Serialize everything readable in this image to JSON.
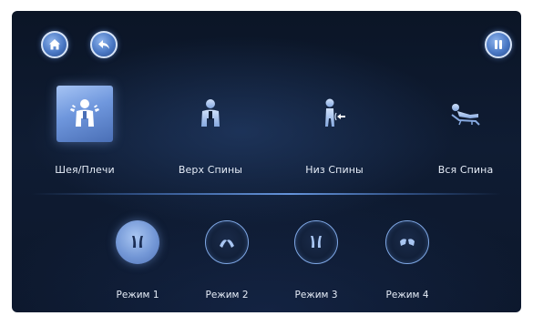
{
  "top_bar": {
    "home_icon": "home-icon",
    "back_icon": "back-arrow-icon",
    "pause_icon": "pause-icon"
  },
  "zones": [
    {
      "label": "Шея/Плечи",
      "icon": "neck-shoulders-icon",
      "selected": true
    },
    {
      "label": "Верх Спины",
      "icon": "upper-back-icon",
      "selected": false
    },
    {
      "label": "Низ Спины",
      "icon": "lower-back-icon",
      "selected": false
    },
    {
      "label": "Вся Спина",
      "icon": "full-back-icon",
      "selected": false
    }
  ],
  "modes": [
    {
      "label": "Режим 1",
      "icon": "mode-1-hands-icon",
      "selected": true
    },
    {
      "label": "Режим 2",
      "icon": "mode-2-hands-icon",
      "selected": false
    },
    {
      "label": "Режим 3",
      "icon": "mode-3-hands-icon",
      "selected": false
    },
    {
      "label": "Режим 4",
      "icon": "mode-4-hands-icon",
      "selected": false
    }
  ],
  "colors": {
    "background": "#0f1c33",
    "accent": "#6f97dd",
    "text": "#e6edf8"
  }
}
